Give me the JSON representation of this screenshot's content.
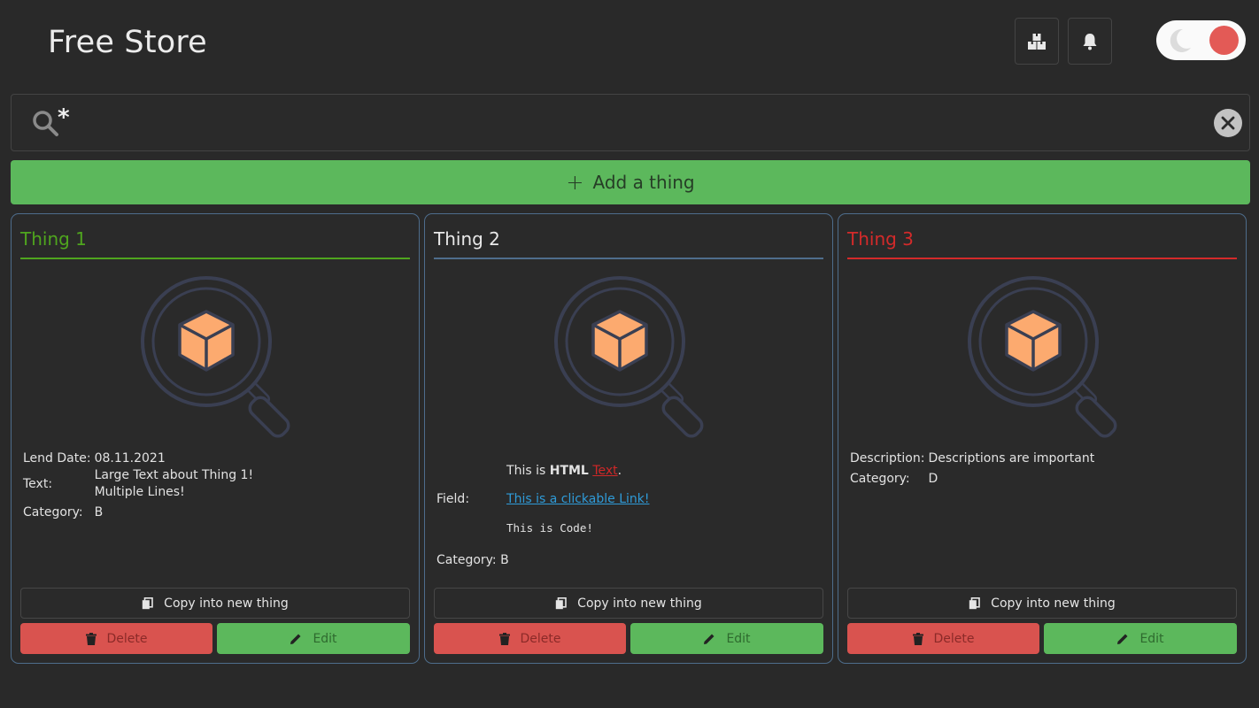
{
  "app": {
    "title": "Free Store"
  },
  "header": {
    "boxes_button_icon": "boxes-icon",
    "notifications_button_icon": "bell-icon",
    "theme_toggle": {
      "state": "on",
      "knob_color": "#e35a56",
      "off_icon": "moon-icon"
    }
  },
  "search": {
    "value": "*",
    "icon": "search-icon",
    "clear_icon": "close-circle-icon"
  },
  "add_button": {
    "icon": "plus",
    "label": "Add a thing",
    "color": "#5cb85c"
  },
  "colors": {
    "card_border": "#4e6d8c",
    "delete": "#d9534f",
    "edit": "#5cb85c",
    "link": "#2f9bd8"
  },
  "cards": [
    {
      "title": "Thing 1",
      "title_color": "#4fa51e",
      "props": [
        {
          "key": "Lend Date:",
          "value": "08.11.2021"
        },
        {
          "key": "Text:",
          "value_lines": [
            "Large Text about Thing 1!",
            "Multiple Lines!"
          ]
        },
        {
          "key": "Category:",
          "value": "B"
        }
      ],
      "copy_label": "Copy into new thing",
      "delete_label": "Delete",
      "edit_label": "Edit"
    },
    {
      "title": "Thing 2",
      "title_color": "#e9e9e9",
      "props": [
        {
          "key": "Field:",
          "html_line_1": {
            "prefix": "This is ",
            "bold": "HTML",
            "space": " ",
            "red_underlined": "Text",
            "suffix": "."
          },
          "link": "This is a clickable Link!",
          "code": "This is Code!"
        },
        {
          "key": "Category:",
          "value": "B"
        }
      ],
      "copy_label": "Copy into new thing",
      "delete_label": "Delete",
      "edit_label": "Edit"
    },
    {
      "title": "Thing 3",
      "title_color": "#d42a2a",
      "props": [
        {
          "key": "Description:",
          "value": "Descriptions are important"
        },
        {
          "key": "Category:",
          "value": "D"
        }
      ],
      "copy_label": "Copy into new thing",
      "delete_label": "Delete",
      "edit_label": "Edit"
    }
  ]
}
